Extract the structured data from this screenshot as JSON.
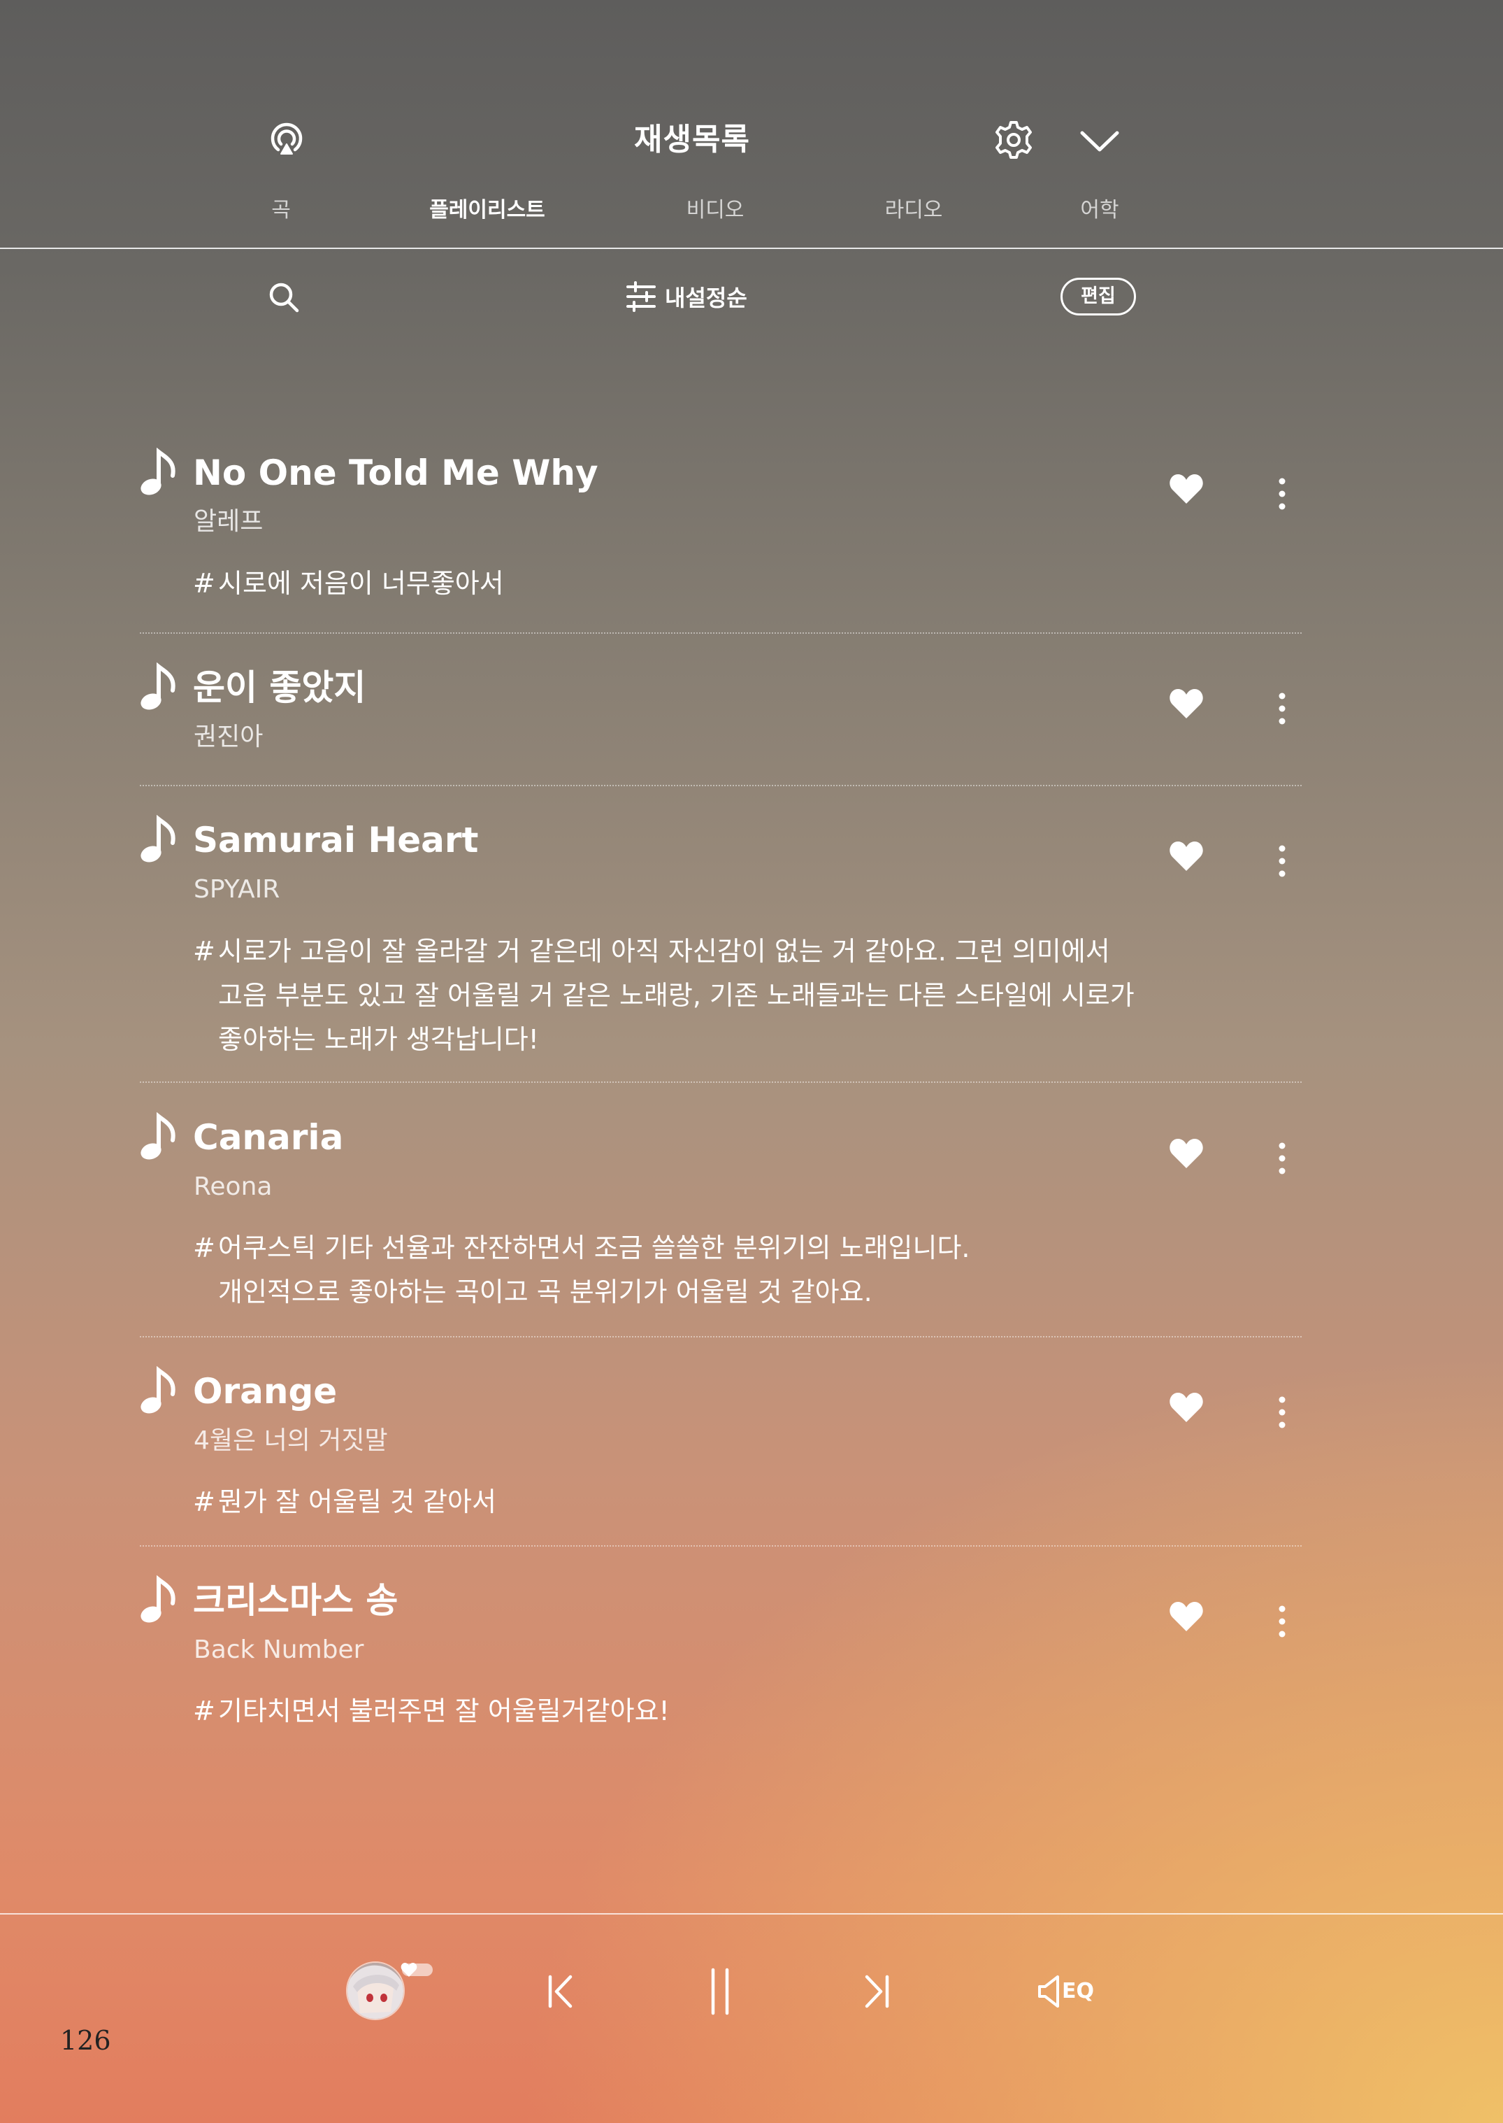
{
  "header": {
    "title": "재생목록",
    "tabs": [
      {
        "label": "곡"
      },
      {
        "label": "플레이리스트"
      },
      {
        "label": "비디오"
      },
      {
        "label": "라디오"
      },
      {
        "label": "어학"
      }
    ],
    "active_tab": "플레이리스트"
  },
  "toolbar": {
    "sort_label": "내설정순",
    "edit_label": "편집"
  },
  "songs": [
    {
      "title": "No One Told Me Why",
      "artist": "알레프",
      "comment": "시로에 저음이 너무좋아서",
      "liked": true
    },
    {
      "title": "운이 좋았지",
      "artist": "권진아",
      "comment": "",
      "liked": true
    },
    {
      "title": "Samurai Heart",
      "artist": "SPYAIR",
      "comment": "시로가 고음이 잘 올라갈 거 같은데 아직 자신감이 없는 거 같아요. 그런 의미에서\n고음 부분도 있고 잘 어울릴 거 같은 노래랑, 기존 노래들과는 다른 스타일에 시로가\n좋아하는 노래가 생각납니다!",
      "liked": true
    },
    {
      "title": "Canaria",
      "artist": "Reona",
      "comment": "어쿠스틱 기타 선율과 잔잔하면서 조금 쓸쓸한 분위기의 노래입니다.\n개인적으로 좋아하는 곡이고 곡 분위기가 어울릴 것 같아요.",
      "liked": true
    },
    {
      "title": "Orange",
      "artist": "4월은 너의 거짓말",
      "comment": "뭔가 잘 어울릴 것 같아서",
      "liked": true
    },
    {
      "title": "크리스마스 송",
      "artist": "Back Number",
      "comment": "기타치면서 불러주면 잘 어울릴거같아요!",
      "liked": true
    }
  ],
  "comment_prefix": "#",
  "player": {
    "eq_label": "EQ"
  },
  "page_number": "126",
  "icons": [
    "airplay-icon",
    "gear-icon",
    "chevron-down-icon",
    "search-icon",
    "sliders-icon",
    "music-note-icon",
    "heart-icon",
    "more-vertical-icon",
    "prev-track-icon",
    "pause-icon",
    "next-track-icon",
    "volume-icon"
  ],
  "colors": {
    "text": "#ffffff",
    "gradient_top": "#5e5d5c",
    "gradient_bottom_left": "#e27d5e",
    "gradient_bottom_right": "#f0c468"
  }
}
